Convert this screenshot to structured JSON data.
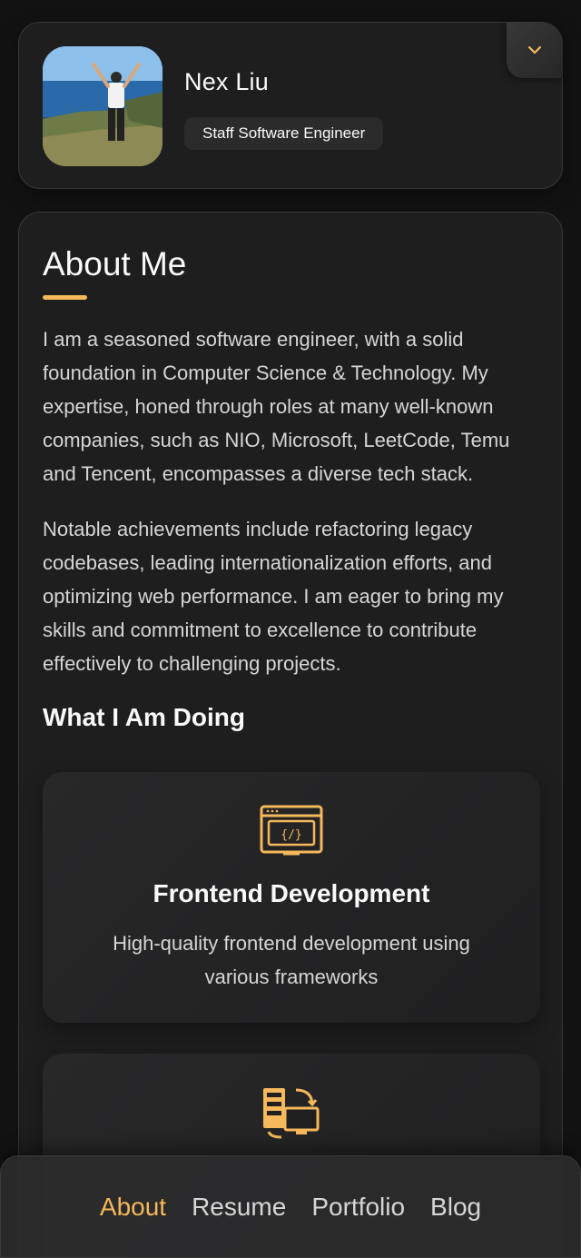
{
  "profile": {
    "name": "Nex Liu",
    "title": "Staff Software Engineer",
    "toggle_icon": "chevron-down-icon"
  },
  "about": {
    "heading": "About Me",
    "paragraphs": [
      "I am a seasoned software engineer, with a solid foundation in Computer Science & Technology. My expertise, honed through roles at many well-known companies, such as NIO, Microsoft, LeetCode, Temu and Tencent, encompasses a diverse tech stack.",
      "Notable achievements include refactoring legacy codebases, leading internationalization efforts, and optimizing web performance. I am eager to bring my skills and commitment to excellence to contribute effectively to challenging projects."
    ],
    "doing_heading": "What I Am Doing",
    "services": [
      {
        "icon": "code-window-icon",
        "title": "Frontend Development",
        "description": "High-quality frontend development using various frameworks"
      },
      {
        "icon": "server-monitor-sync-icon",
        "title": "",
        "description": ""
      }
    ]
  },
  "nav": {
    "items": [
      {
        "label": "About",
        "active": true
      },
      {
        "label": "Resume",
        "active": false
      },
      {
        "label": "Portfolio",
        "active": false
      },
      {
        "label": "Blog",
        "active": false
      }
    ]
  },
  "colors": {
    "accent": "#f5b85a",
    "background": "#121212",
    "card": "#1e1e1f",
    "text": "#d6d6d6"
  }
}
